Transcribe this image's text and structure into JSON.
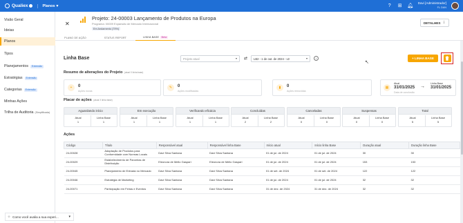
{
  "topbar": {
    "brand": "Qualiex",
    "module": "Planos",
    "user_name": "Davi [Administrador]",
    "user_sub": "FL DAN",
    "icons": [
      "help-icon",
      "grid-icon",
      "bell-icon"
    ]
  },
  "sidebar": {
    "items": [
      {
        "label": "Visão Geral",
        "badge": "",
        "sub": ""
      },
      {
        "label": "Ideias",
        "badge": "",
        "sub": ""
      },
      {
        "label": "Planos",
        "badge": "",
        "sub": ""
      },
      {
        "label": "Tipos",
        "badge": "",
        "sub": ""
      },
      {
        "label": "Planejamentos",
        "badge": "Extensão",
        "sub": ""
      },
      {
        "label": "Estratégias",
        "badge": "Extensão",
        "sub": ""
      },
      {
        "label": "Categorias",
        "badge": "Extensão",
        "sub": ""
      },
      {
        "label": "Minhas Ações",
        "badge": "",
        "sub": ""
      },
      {
        "label": "Trilha de Auditoria",
        "badge": "",
        "sub": "(Simplificada)"
      }
    ]
  },
  "project": {
    "title": "Projeto: 24-00003 Lançamento de Produtos na Europa",
    "program": "Programa: 00009 Expansão de Mercado Internacional",
    "status": "Em Andamento (79%)",
    "details_label": "DETALHES"
  },
  "tabs": [
    {
      "label": "PLANO DE AÇÃO",
      "beta": ""
    },
    {
      "label": "STATUS REPORT",
      "beta": ""
    },
    {
      "label": "LINHA BASE",
      "beta": "Beta"
    }
  ],
  "baseline": {
    "title": "Linha Base",
    "select_project_placeholder": "Projeto atual",
    "select_baseline_value": "LB2 - 1 de out. de 2024 - v2",
    "add_button_label": "+ LINHA BASE"
  },
  "summary": {
    "title": "Resumo de alterações do Projeto",
    "note": "(atual X linha base)",
    "cards": [
      {
        "value": "0",
        "label": "Ações novas"
      },
      {
        "value": "0",
        "label": "Ações modificadas"
      },
      {
        "value": "0",
        "label": "Ações removidas"
      }
    ],
    "period": {
      "current_label": "Atual",
      "current_date": "31/01/2025",
      "baseline_label": "Linha Base",
      "baseline_date": "31/01/2025",
      "caption": "Data de conclusão"
    }
  },
  "placar": {
    "title": "Placar de ações",
    "note": "(atual X linha base)",
    "columns": [
      {
        "label": "Aguardando início",
        "atual": "1",
        "base": "1"
      },
      {
        "label": "Em execução",
        "atual": "1",
        "base": "1"
      },
      {
        "label": "Verificando eficácia",
        "atual": "1",
        "base": "1"
      },
      {
        "label": "Concluídas",
        "atual": "2",
        "base": "2"
      },
      {
        "label": "Canceladas",
        "atual": "0",
        "base": "0"
      },
      {
        "label": "Suspensas",
        "atual": "0",
        "base": "0"
      },
      {
        "label": "Total",
        "atual": "5",
        "base": "5"
      }
    ],
    "atual_label": "Atual",
    "base_label": "Linha Base"
  },
  "acoes": {
    "title": "Ações",
    "headers": [
      "Código",
      "Título",
      "Responsável atual",
      "Responsável linha Base",
      "Início atual",
      "Início linha Base",
      "Duração atual",
      "Duração linha Base"
    ],
    "rows": [
      [
        "24-00028",
        "Adaptação de Produtos para Conformidade com Normas Locais",
        "Davi Silva Santana",
        "Davi Silva Santana",
        "01 de jul. de 2024",
        "01 de jul. de 2024",
        "30",
        "30"
      ],
      [
        "24-00029",
        "Estabelecimento de Parcerias de Distribuição",
        "Eleonora de Mello Gaspari",
        "Eleonora de Mello Gaspari",
        "01 de jul. de 2024",
        "01 de jul. de 2024",
        "153",
        "153"
      ],
      [
        "24-00045",
        "Planejamento de Entrada no Mercado",
        "Davi Silva Santana",
        "Davi Silva Santana",
        "01 de set. de 2024",
        "01 de set. de 2024",
        "122",
        "122"
      ],
      [
        "24-00046",
        "Estratégia de Marketing",
        "Davi Silva Santana",
        "Davi Silva Santana",
        "01 de jul. de 2024",
        "01 de jul. de 2024",
        "32",
        "32"
      ],
      [
        "24-00071",
        "Participação em Feiras e Eventos",
        "Davi Silva Santana",
        "Davi Silva Santana",
        "31 de dez. de 2024",
        "31 de dez. de 2024",
        "32",
        "32"
      ]
    ]
  },
  "feedback": {
    "label": "Como você avalia a sua experi..."
  },
  "colors": {
    "primary": "#1f6fd6",
    "accent": "#f7a600",
    "highlight": "#d42020"
  }
}
